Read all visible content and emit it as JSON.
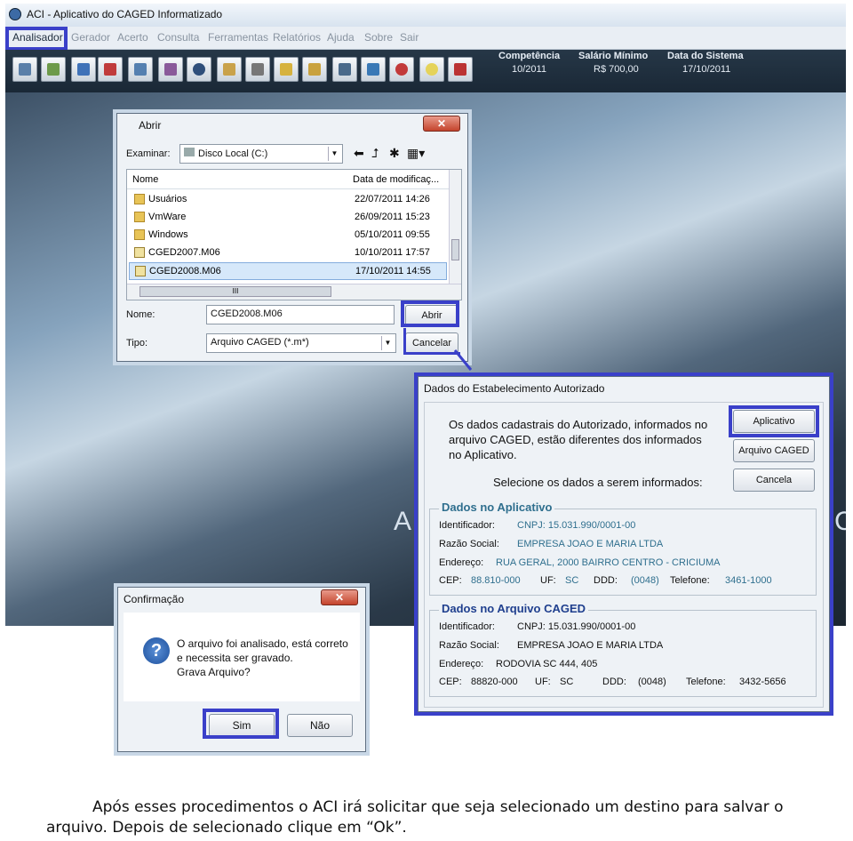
{
  "window": {
    "title": "ACI - Aplicativo do CAGED Informatizado"
  },
  "menu": [
    "Analisador",
    "Gerador",
    "Acerto",
    "Consulta",
    "Ferramentas",
    "Relatórios",
    "Ajuda",
    "Sobre",
    "Sair"
  ],
  "toolbar_icons": [
    "chart-icon",
    "edit-icon",
    "tools-icon",
    "save-icon",
    "print-preview-icon",
    "settings-icon",
    "search-icon",
    "pencil-icon",
    "copy-icon",
    "lock-icon",
    "lock-save-icon",
    "printer-icon",
    "network-icon",
    "delete-icon",
    "lightbulb-icon",
    "exit-icon"
  ],
  "status": {
    "competencia_label": "Competência",
    "competencia": "10/2011",
    "salario_label": "Salário Mínimo",
    "salario": "R$ 700,00",
    "data_label": "Data do Sistema",
    "data": "17/10/2011"
  },
  "open_dialog": {
    "title": "Abrir",
    "look_in_label": "Examinar:",
    "look_in": "Disco Local (C:)",
    "col_name": "Nome",
    "col_date": "Data de modificaç...",
    "files": [
      {
        "name": "Usuários",
        "date": "22/07/2011 14:26",
        "type": "folder"
      },
      {
        "name": "VmWare",
        "date": "26/09/2011 15:23",
        "type": "folder"
      },
      {
        "name": "Windows",
        "date": "05/10/2011 09:55",
        "type": "folder"
      },
      {
        "name": "CGED2007.M06",
        "date": "10/10/2011 17:57",
        "type": "file"
      },
      {
        "name": "CGED2008.M06",
        "date": "17/10/2011 14:55",
        "type": "file"
      }
    ],
    "name_label": "Nome:",
    "name_value": "CGED2008.M06",
    "type_label": "Tipo:",
    "type_value": "Arquivo CAGED (*.m*)",
    "open_btn": "Abrir",
    "cancel_btn": "Cancelar",
    "scroll_mark": "III"
  },
  "estab_dialog": {
    "title": "Dados do Estabelecimento Autorizado",
    "msg1": "Os dados cadastrais do Autorizado, informados no",
    "msg2": "arquivo CAGED, estão diferentes dos informados",
    "msg3": "no Aplicativo.",
    "select_msg": "Selecione os dados a serem informados:",
    "btn_app": "Aplicativo",
    "btn_caged": "Arquivo CAGED",
    "btn_cancel": "Cancela",
    "app_group": {
      "title": "Dados no Aplicativo",
      "id_label": "Identificador:",
      "id": "CNPJ: 15.031.990/0001-00",
      "razao_label": "Razão Social:",
      "razao": "EMPRESA JOAO E MARIA LTDA",
      "end_label": "Endereço:",
      "end": "RUA GERAL, 2000 BAIRRO CENTRO - CRICIUMA",
      "cep_label": "CEP:",
      "cep": "88.810-000",
      "uf_label": "UF:",
      "uf": "SC",
      "ddd_label": "DDD:",
      "ddd": "(0048)",
      "tel_label": "Telefone:",
      "tel": "3461-1000"
    },
    "caged_group": {
      "title": "Dados no Arquivo CAGED",
      "id_label": "Identificador:",
      "id": "CNPJ: 15.031.990/0001-00",
      "razao_label": "Razão Social:",
      "razao": "EMPRESA JOAO E MARIA LTDA",
      "end_label": "Endereço:",
      "end": "RODOVIA SC 444, 405",
      "cep_label": "CEP:",
      "cep": "88820-000",
      "uf_label": "UF:",
      "uf": "SC",
      "ddd_label": "DDD:",
      "ddd": "(0048)",
      "tel_label": "Telefone:",
      "tel": "3432-5656"
    }
  },
  "confirm_dialog": {
    "title": "Confirmação",
    "line1": "O arquivo foi analisado, está correto",
    "line2": "e necessita ser gravado.",
    "line3": "Grava Arquivo?",
    "yes": "Sim",
    "no": "Não"
  },
  "bg_logo": "A",
  "bg_logo2": "C",
  "caption": {
    "line1": "Após esses procedimentos o ACI irá solicitar que seja selecionado um destino para salvar o",
    "line2": "arquivo. Depois de selecionado clique em “Ok”."
  },
  "colors": {
    "highlight": "#3a40c9",
    "accent_text": "#2f6f8e"
  }
}
